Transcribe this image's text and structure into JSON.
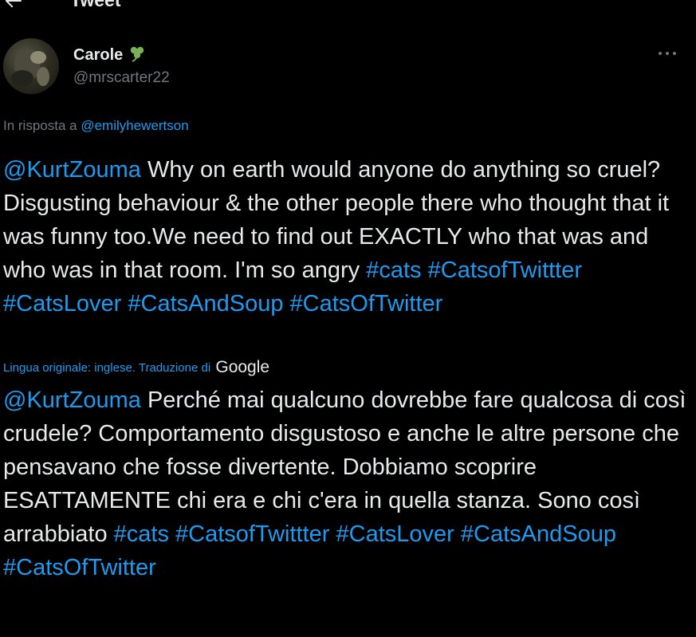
{
  "topbar": {
    "title": "Tweet",
    "back_icon": "arrow-left-icon"
  },
  "author": {
    "display_name": "Carole",
    "emoji_icon": "shamrock-icon",
    "handle": "@mrscarter22",
    "more_icon": "more-dots-icon"
  },
  "reply": {
    "prefix": "In risposta a ",
    "mention": "@emilyhewertson"
  },
  "original": {
    "mention": "@KurtZouma",
    "text": " Why on earth would anyone do anything so cruel? Disgusting behaviour & the other people there who thought that it was funny too.We need to find out EXACTLY who that was and who was in that room. I'm so angry ",
    "hashtags": [
      "#cats",
      "#CatsofTwittter",
      "#CatsLover",
      "#CatsAndSoup",
      "#CatsOfTwitter"
    ]
  },
  "translation": {
    "label": "Lingua originale: inglese. Traduzione di",
    "provider": "Google"
  },
  "translated": {
    "mention": "@KurtZouma",
    "text": " Perché mai qualcuno dovrebbe fare qualcosa di così crudele? Comportamento disgustoso e anche le altre persone che pensavano che fosse divertente. Dobbiamo scoprire ESATTAMENTE chi era e chi c'era in quella stanza. Sono così arrabbiato ",
    "hashtags": [
      "#cats",
      "#CatsofTwittter",
      "#CatsLover",
      "#CatsAndSoup",
      "#CatsOfTwitter"
    ]
  },
  "colors": {
    "background": "#000000",
    "text": "#e7e9ea",
    "secondary": "#71767b",
    "accent": "#1d9bf0",
    "shamrock": "#77b255"
  }
}
